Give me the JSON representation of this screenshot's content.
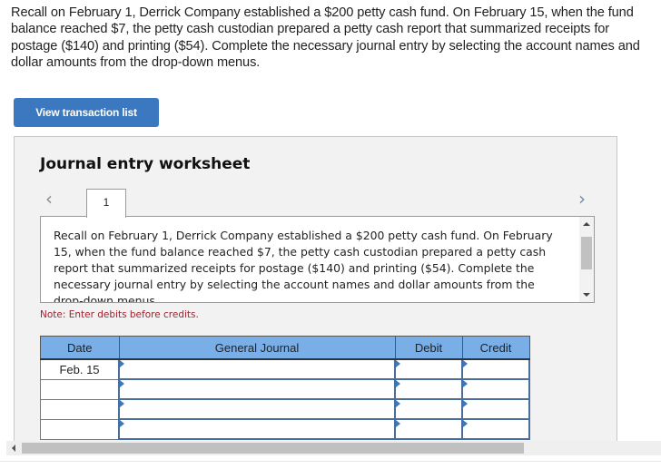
{
  "question": {
    "text": "Recall on February 1, Derrick Company established a $200 petty cash fund. On February 15, when the fund balance reached $7, the petty cash custodian prepared a petty cash report that summarized receipts for postage ($140) and printing ($54). Complete the necessary journal entry by selecting the account names and dollar amounts from the drop-down menus."
  },
  "buttons": {
    "view_transaction_list": "View transaction list"
  },
  "worksheet": {
    "title": "Journal entry worksheet",
    "prev_icon": "‹",
    "next_icon": "›",
    "tab_label": "1",
    "description": "Recall on February 1, Derrick Company established a $200 petty cash fund. On February 15, when the fund balance reached $7, the petty cash custodian prepared a petty cash report that summarized receipts for postage ($140) and printing ($54). Complete the necessary journal entry by selecting the account names and dollar amounts from the drop-down menus.",
    "note": "Note: Enter debits before credits."
  },
  "journal": {
    "headers": {
      "date": "Date",
      "general_journal": "General Journal",
      "debit": "Debit",
      "credit": "Credit"
    },
    "rows": [
      {
        "date": "Feb. 15",
        "account": "",
        "debit": "",
        "credit": ""
      },
      {
        "date": "",
        "account": "",
        "debit": "",
        "credit": ""
      },
      {
        "date": "",
        "account": "",
        "debit": "",
        "credit": ""
      },
      {
        "date": "",
        "account": "",
        "debit": "",
        "credit": ""
      }
    ]
  },
  "colors": {
    "button_blue": "#3b78bf",
    "header_blue": "#7aaee6",
    "note_red": "#a3202f"
  }
}
